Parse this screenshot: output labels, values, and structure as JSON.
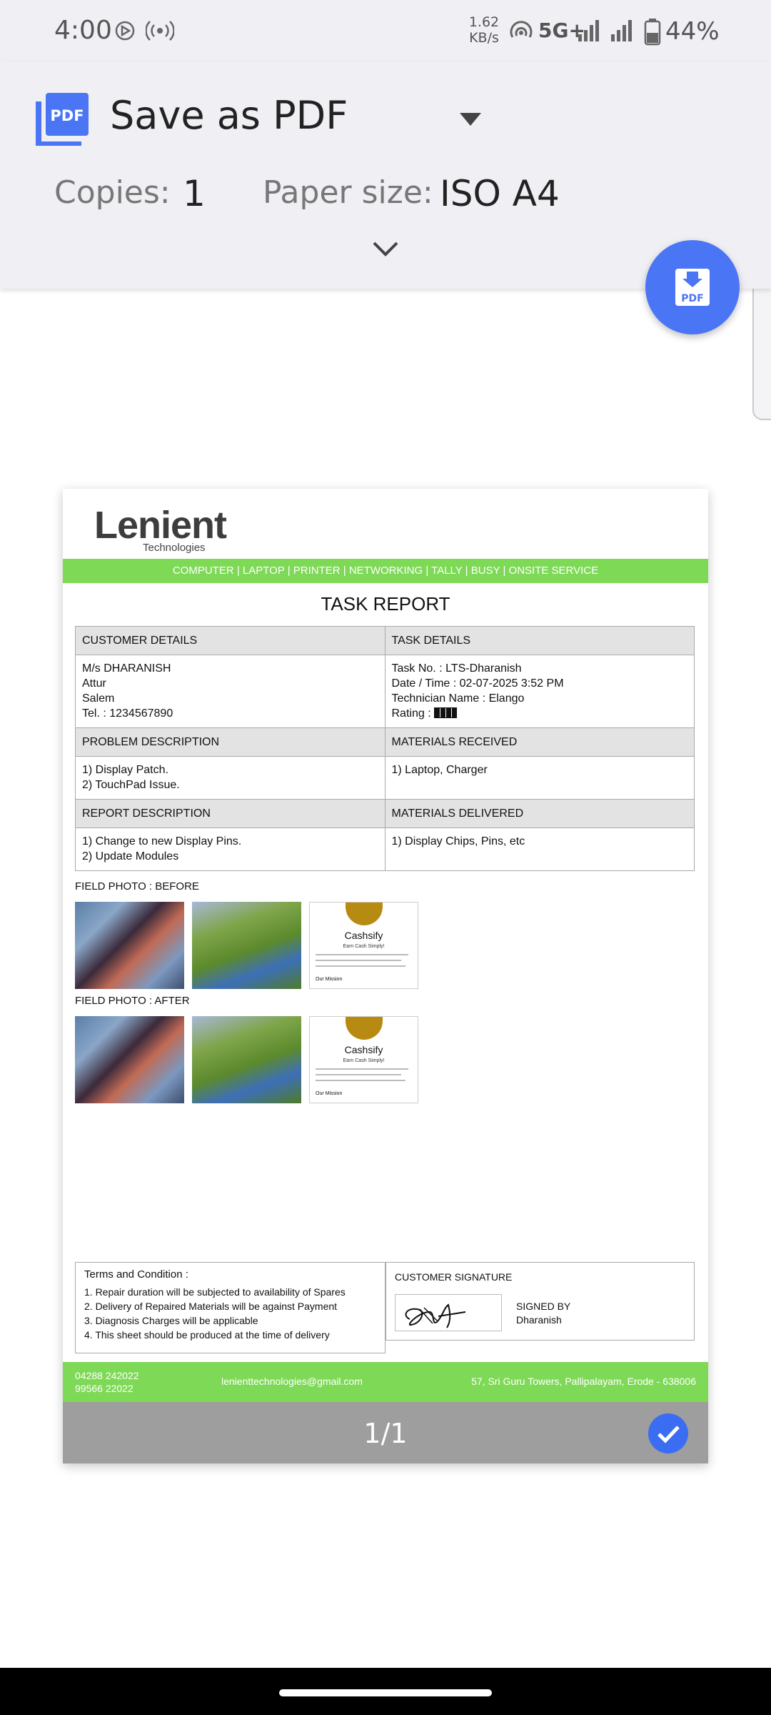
{
  "status_bar": {
    "time": "4:00",
    "speed_value": "1.62",
    "speed_unit": "KB/s",
    "network": "5G+",
    "battery": "44%"
  },
  "print_header": {
    "destination": "Save as PDF",
    "copies_label": "Copies:",
    "copies_value": "1",
    "paper_size_label": "Paper size:",
    "paper_size_value": "ISO A4",
    "pdf_badge": "PDF",
    "fab_badge": "PDF"
  },
  "document": {
    "logo_main": "Lenient",
    "logo_sub": "Technologies",
    "services": "COMPUTER | LAPTOP | PRINTER | NETWORKING | TALLY | BUSY | ONSITE SERVICE",
    "title": "TASK REPORT",
    "customer_details_header": "CUSTOMER DETAILS",
    "task_details_header": "TASK DETAILS",
    "customer_lines": [
      "M/s DHARANISH",
      "Attur",
      "Salem",
      "Tel. : 1234567890"
    ],
    "task_lines": [
      "Task No. : LTS-Dharanish",
      "Date / Time : 02-07-2025 3:52 PM",
      "Technician Name : Elango"
    ],
    "rating_label": "Rating :",
    "problem_header": "PROBLEM DESCRIPTION",
    "materials_received_header": "MATERIALS RECEIVED",
    "problem_lines": [
      "1) Display Patch.",
      "2) TouchPad Issue."
    ],
    "materials_received_lines": [
      "1) Laptop, Charger"
    ],
    "report_header": "REPORT DESCRIPTION",
    "materials_delivered_header": "MATERIALS DELIVERED",
    "report_lines": [
      "1) Change to new Display Pins.",
      "2) Update Modules"
    ],
    "materials_delivered_lines": [
      "1) Display Chips, Pins, etc"
    ],
    "photo_before_label": "FIELD PHOTO : BEFORE",
    "photo_after_label": "FIELD PHOTO : AFTER",
    "photo_card_title": "Cashsify",
    "photo_card_subtitle": "Earn Cash Simply!",
    "photo_card_section": "Our Mission",
    "terms_title": "Terms and Condition :",
    "terms": [
      "1. Repair duration will be subjected to availability of Spares",
      "2. Delivery of Repaired Materials will be against Payment",
      "3. Diagnosis Charges will be applicable",
      "4. This sheet should be produced at the time of delivery"
    ],
    "signature_label": "CUSTOMER SIGNATURE",
    "signed_by_label": "SIGNED BY",
    "signed_by_name": "Dharanish",
    "footer_phone_1": "04288 242022",
    "footer_phone_2": "99566 22022",
    "footer_email": "lenienttechnologies@gmail.com",
    "footer_address": "57, Sri Guru Towers, Pallipalayam, Erode - 638006"
  },
  "page_indicator": "1/1",
  "colors": {
    "accent_blue": "#4a75f5",
    "brand_green": "#7ed957",
    "panel_bg": "#efeff4"
  }
}
